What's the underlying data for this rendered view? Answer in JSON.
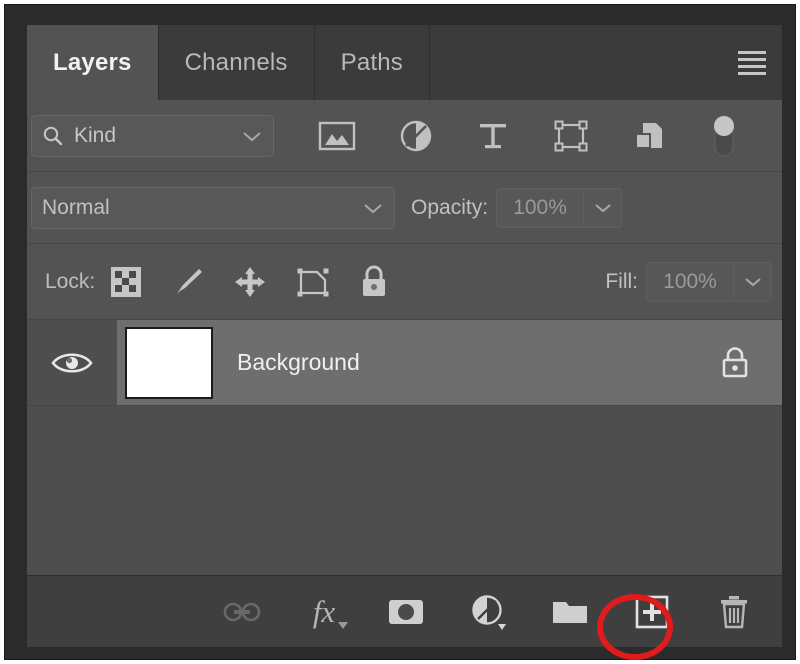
{
  "panel": {
    "title": "Layers",
    "tabs": [
      {
        "label": "Layers",
        "active": true
      },
      {
        "label": "Channels",
        "active": false
      },
      {
        "label": "Paths",
        "active": false
      }
    ],
    "menu_icon": "hamburger-menu-icon"
  },
  "filter": {
    "kind_label": "Kind",
    "search_icon": "search-icon",
    "dropdown_icon": "chevron-down-icon",
    "icons": [
      "pixel-layer-filter-icon",
      "adjustment-layer-filter-icon",
      "type-layer-filter-icon",
      "shape-layer-filter-icon",
      "smart-object-filter-icon",
      "filter-toggle-switch"
    ]
  },
  "blend": {
    "mode": "Normal",
    "opacity_label": "Opacity:",
    "opacity_value": "100%"
  },
  "lock": {
    "label": "Lock:",
    "icons": [
      "lock-transparent-pixels-icon",
      "lock-image-pixels-icon",
      "lock-position-icon",
      "lock-artboard-nesting-icon",
      "lock-all-icon"
    ],
    "fill_label": "Fill:",
    "fill_value": "100%"
  },
  "layers": [
    {
      "name": "Background",
      "visible": true,
      "locked": true,
      "selected": true,
      "thumbnail_color": "#ffffff"
    }
  ],
  "toolbar": {
    "buttons": [
      {
        "name": "link-layers-button",
        "icon": "link-icon",
        "enabled": false
      },
      {
        "name": "layer-styles-button",
        "icon": "fx-icon",
        "enabled": true
      },
      {
        "name": "add-layer-mask-button",
        "icon": "mask-icon",
        "enabled": true
      },
      {
        "name": "new-adjustment-button",
        "icon": "adjustment-icon",
        "enabled": true
      },
      {
        "name": "new-group-button",
        "icon": "folder-icon",
        "enabled": true
      },
      {
        "name": "new-layer-button",
        "icon": "new-layer-icon",
        "enabled": true
      },
      {
        "name": "delete-layer-button",
        "icon": "trash-icon",
        "enabled": true
      }
    ],
    "highlight": {
      "target": "new-layer-button",
      "shape": "ellipse",
      "color": "#e01b1b"
    }
  },
  "colors": {
    "panel_bg": "#535353",
    "tabbar_bg": "#3b3b3b",
    "list_bg": "#4e4e4e",
    "row_selected": "#6e6e6e",
    "bottom_bar_bg": "#3f3f3f",
    "text": "#c6c6c6",
    "annotation": "#e01b1b"
  }
}
